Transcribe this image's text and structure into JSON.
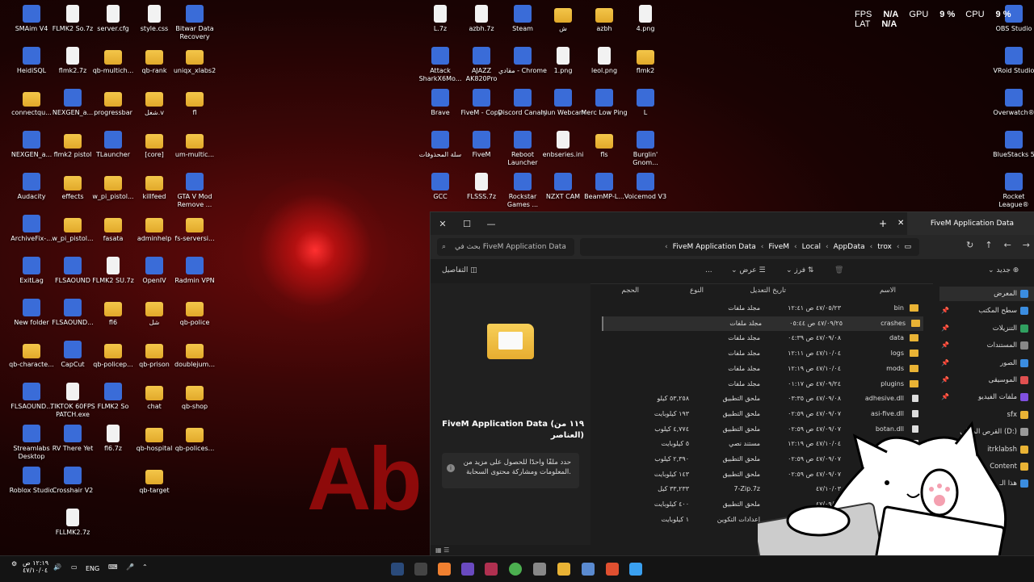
{
  "desktop": {
    "icons_col1": [
      "SMAim V4",
      "HeidiSQL",
      "connectqu...",
      "NEXGEN_a...",
      "Audacity",
      "ArchiveFix-...",
      "ExitLag",
      "New folder",
      "qb-characte...",
      "FLSAOUND...",
      "Streamlabs Desktop",
      "Roblox Studio"
    ],
    "icons_col2": [
      "FLMK2 So.7z",
      "flmk2.7z",
      "NEXGEN_a...",
      "flmk2 pistol",
      "effects",
      "w_pi_pistol...",
      "FLSAOUND",
      "FLSAOUND...",
      "CapCut",
      "TIKTOK 60FPS PATCH.exe",
      "RV There Yet",
      "Crosshair V2",
      "FLLMK2.7z"
    ],
    "icons_col3": [
      "server.cfg",
      "qb-multich...",
      "progressbar",
      "TLauncher",
      "w_pi_pistol...",
      "fasata",
      "FLMK2 SU.7z",
      "fl6",
      "qb-policep...",
      "FLMK2 So",
      "fl6.7z"
    ],
    "icons_col4": [
      "style.css",
      "qb-rank",
      "شغل.v",
      "[core]",
      "killfeed",
      "adminhelp",
      "OpenIV",
      "شل",
      "qb-prison",
      "chat",
      "qb-hospital",
      "qb-target"
    ],
    "icons_col5": [
      "Bitwar Data Recovery",
      "uniqx_xlabs2",
      "fl",
      "um-multic...",
      "GTA V Mod Remove ...",
      "fs-serversi...",
      "Radmin VPN",
      "qb-police",
      "doublejum...",
      "qb-shop",
      "qb-polices..."
    ],
    "icons_mid1": [
      "L.7z",
      "Attack SharkX6Mo...",
      "Brave",
      "سلة المحذوفات",
      "GCC"
    ],
    "icons_mid2": [
      "azbh.7z",
      "AJAZZ AK820Pro",
      "FiveM - Copy",
      "FiveM",
      "FLSSS.7z"
    ],
    "icons_mid3": [
      "Steam",
      "مقادي - Chrome",
      "Discord Canary",
      "Reboot Launcher",
      "Rockstar Games ..."
    ],
    "icons_mid4": [
      "ش",
      "1.png",
      "Iriun Webcam",
      "enbseries.ini",
      "NZXT CAM"
    ],
    "icons_mid5": [
      "azbh",
      "leol.png",
      "Merc Low Ping",
      "fls",
      "BeamMP-L..."
    ],
    "icons_mid6": [
      "4.png",
      "flmk2",
      "L",
      "Burglin' Gnom...",
      "Voicemod V3"
    ],
    "icons_right": [
      "OBS Studio",
      "VRoid Studio",
      "Overwatch®",
      "BlueStacks 5",
      "Rocket League®",
      "Discord"
    ],
    "wallpaper_text": "Ab"
  },
  "overlay": {
    "fps_label": "FPS",
    "fps": "N/A",
    "gpu_label": "GPU",
    "gpu": "9 %",
    "cpu_label": "CPU",
    "cpu": "9 %",
    "lat_label": "LAT",
    "lat": "N/A"
  },
  "explorer": {
    "tab_title": "FiveM Application Data",
    "search_placeholder": "بحث في FiveM Application Data",
    "breadcrumb": [
      "FiveM Application Data",
      "FiveM",
      "Local",
      "AppData",
      "trox"
    ],
    "toolbar": {
      "new": "جديد",
      "sort": "فرز",
      "view": "عرض",
      "more": "...",
      "details": "التفاصيل"
    },
    "columns": {
      "name": "الاسم",
      "modified": "تاريخ التعديل",
      "type": "النوع",
      "size": "الحجم"
    },
    "files": [
      {
        "name": "bin",
        "date": "٤٧/٠٥/٢٣ ص ١٢:٤١",
        "type": "مجلد ملفات",
        "size": "",
        "kind": "folder"
      },
      {
        "name": "crashes",
        "date": "٤٧/٠٩/٢٥ ص ٠٥:٤٤",
        "type": "مجلد ملفات",
        "size": "",
        "kind": "folder"
      },
      {
        "name": "data",
        "date": "٤٧/٠٩/٠٨ ص ٠٤:٣٩",
        "type": "مجلد ملفات",
        "size": "",
        "kind": "folder"
      },
      {
        "name": "logs",
        "date": "٤٧/١٠/٠٤ ص ١٢:١١",
        "type": "مجلد ملفات",
        "size": "",
        "kind": "folder"
      },
      {
        "name": "mods",
        "date": "٤٧/١٠/٠٤ ص ١٢:١٩",
        "type": "مجلد ملفات",
        "size": "",
        "kind": "folder"
      },
      {
        "name": "plugins",
        "date": "٤٧/٠٩/٢٤ ص ٠١:١٧",
        "type": "مجلد ملفات",
        "size": "",
        "kind": "folder"
      },
      {
        "name": "adhesive.dll",
        "date": "٤٧/٠٩/٠٨ ص ٠٣:٣٥",
        "type": "ملحق التطبيق",
        "size": "٥٣,٢٥٨ كيلو",
        "kind": "doc"
      },
      {
        "name": "asi-five.dll",
        "date": "٤٧/٠٩/٠٧ ص ٠٢:٥٩",
        "type": "ملحق التطبيق",
        "size": "١٩٣ كيلوبايت",
        "kind": "doc"
      },
      {
        "name": "botan.dll",
        "date": "٤٧/٠٩/٠٧ ص ٠٢:٥٩",
        "type": "ملحق التطبيق",
        "size": "٤,٧٧٤ كيلوب",
        "kind": "doc"
      },
      {
        "name": "",
        "date": "٤٧/١٠/٠٤ ص ١٢:١٩",
        "type": "مستند نصي",
        "size": "٥ كيلوبايت",
        "kind": "doc"
      },
      {
        "name": "",
        "date": "٤٧/٠٩/٠٧ ص ٠٢:٥٩",
        "type": "ملحق التطبيق",
        "size": "٢,٣٩٠ كيلوب",
        "kind": "doc"
      },
      {
        "name": "",
        "date": "٤٧/٠٩/٠٧ ص ٠٢:٥٩",
        "type": "ملحق التطبيق",
        "size": "١٤٣ كيلوبايت",
        "kind": "doc"
      },
      {
        "name": "",
        "date": "٤٧/١٠/٠٣",
        "type": "7-Zip.7z",
        "size": "٣٣,٢٣٣ كيل",
        "kind": "doc"
      },
      {
        "name": "",
        "date": "٤٧/٠٩/٠٧",
        "type": "ملحق التطبيق",
        "size": "٤٠٠ كيلوبايت",
        "kind": "doc"
      },
      {
        "name": "",
        "date": "٤٧/١٠/٠٤",
        "type": "إعدادات التكوين",
        "size": "١ كيلوبايت",
        "kind": "doc"
      }
    ],
    "nav": [
      {
        "label": "المعرض",
        "color": "#3b8de0"
      },
      {
        "label": "سطح المكتب",
        "color": "#3b8de0"
      },
      {
        "label": "التنزيلات",
        "color": "#30a060"
      },
      {
        "label": "المستندات",
        "color": "#888888"
      },
      {
        "label": "الصور",
        "color": "#3b8de0"
      },
      {
        "label": "الموسيقى",
        "color": "#e05050"
      },
      {
        "label": "ملفات الفيديو",
        "color": "#8050e0"
      },
      {
        "label": "sfx",
        "color": "#e9b335"
      },
      {
        "label": "القرص المحلي (D:)",
        "color": "#999999"
      },
      {
        "label": "itrklabsh",
        "color": "#e9b335"
      },
      {
        "label": "Content",
        "color": "#e9b335"
      },
      {
        "label": "هذا الـ",
        "color": "#3b8de0"
      }
    ],
    "details_title": "FiveM Application Data (١١٩ من العناصر)",
    "details_info": "حدد ملفًا واحدًا للحصول على مزيد من المعلومات ومشاركة محتوى السحابة."
  },
  "taskbar": {
    "time": "١٢:١٩ ص",
    "date": "٤٧/١٠/٠٤",
    "lang": "ENG"
  }
}
